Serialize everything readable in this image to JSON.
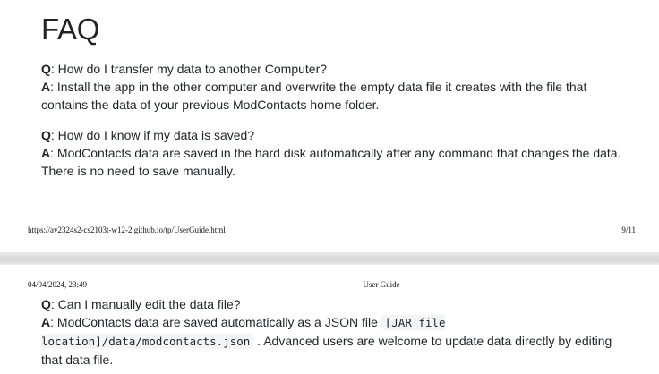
{
  "page1": {
    "heading": "FAQ",
    "faq": [
      {
        "q_label": "Q",
        "question": ": How do I transfer my data to another Computer?",
        "a_label": "A",
        "answer": ": Install the app in the other computer and overwrite the empty data file it creates with the file that contains the data of your previous ModContacts home folder."
      },
      {
        "q_label": "Q",
        "question": ": How do I know if my data is saved?",
        "a_label": "A",
        "answer": ": ModContacts data are saved in the hard disk automatically after any command that changes the data. There is no need to save manually."
      }
    ],
    "footer": {
      "url": "https://ay2324s2-cs2103t-w12-2.github.io/tp/UserGuide.html",
      "page_number": "9/11"
    }
  },
  "page2": {
    "header": {
      "date": "04/04/2024, 23:49",
      "title": "User Guide"
    },
    "faq": {
      "q_label": "Q",
      "question": ": Can I manually edit the data file?",
      "a_label": "A",
      "answer_before": ": ModContacts data are saved automatically as a JSON file ",
      "code": "[JAR file location]/data/modcontacts.json",
      "answer_after": " . Advanced users are welcome to update data directly by editing that data file."
    }
  }
}
